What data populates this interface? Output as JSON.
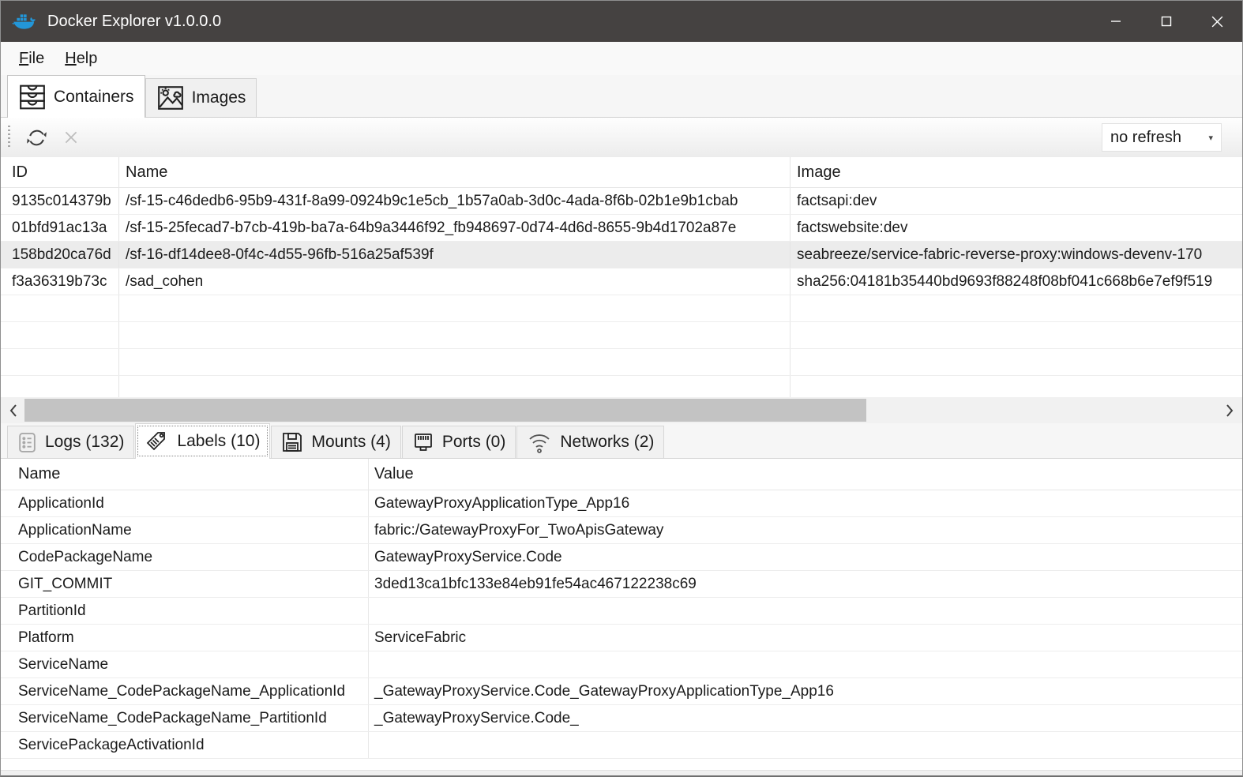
{
  "titlebar": {
    "title": "Docker Explorer v1.0.0.0"
  },
  "menubar": {
    "items": [
      {
        "label": "File"
      },
      {
        "label": "Help"
      }
    ]
  },
  "main_tabs": [
    {
      "label": "Containers",
      "active": true
    },
    {
      "label": "Images",
      "active": false
    }
  ],
  "toolbar": {
    "refresh_mode": "no refresh"
  },
  "containers_table": {
    "columns": [
      "ID",
      "Name",
      "Image"
    ],
    "selected_row_index": 2,
    "rows": [
      {
        "id": "9135c014379b",
        "name": "/sf-15-c46dedb6-95b9-431f-8a99-0924b9c1e5cb_1b57a0ab-3d0c-4ada-8f6b-02b1e9b1cbab",
        "image": "factsapi:dev"
      },
      {
        "id": "01bfd91ac13a",
        "name": "/sf-15-25fecad7-b7cb-419b-ba7a-64b9a3446f92_fb948697-0d74-4d6d-8655-9b4d1702a87e",
        "image": "factswebsite:dev"
      },
      {
        "id": "158bd20ca76d",
        "name": "/sf-16-df14dee8-0f4c-4d55-96fb-516a25af539f",
        "image": "seabreeze/service-fabric-reverse-proxy:windows-devenv-170"
      },
      {
        "id": "f3a36319b73c",
        "name": "/sad_cohen",
        "image": "sha256:04181b35440bd9693f88248f08bf041c668b6e7ef9f519"
      }
    ]
  },
  "detail_tabs": [
    {
      "label": "Logs (132)",
      "active": false
    },
    {
      "label": "Labels (10)",
      "active": true
    },
    {
      "label": "Mounts (4)",
      "active": false
    },
    {
      "label": "Ports (0)",
      "active": false
    },
    {
      "label": "Networks (2)",
      "active": false
    }
  ],
  "labels_table": {
    "columns": [
      "Name",
      "Value"
    ],
    "rows": [
      {
        "name": "ApplicationId",
        "value": "GatewayProxyApplicationType_App16"
      },
      {
        "name": "ApplicationName",
        "value": "fabric:/GatewayProxyFor_TwoApisGateway"
      },
      {
        "name": "CodePackageName",
        "value": "GatewayProxyService.Code"
      },
      {
        "name": "GIT_COMMIT",
        "value": "3ded13ca1bfc133e84eb91fe54ac467122238c69"
      },
      {
        "name": "PartitionId",
        "value": ""
      },
      {
        "name": "Platform",
        "value": "ServiceFabric"
      },
      {
        "name": "ServiceName",
        "value": ""
      },
      {
        "name": "ServiceName_CodePackageName_ApplicationId",
        "value": "_GatewayProxyService.Code_GatewayProxyApplicationType_App16"
      },
      {
        "name": "ServiceName_CodePackageName_PartitionId",
        "value": "_GatewayProxyService.Code_"
      },
      {
        "name": "ServicePackageActivationId",
        "value": ""
      }
    ]
  },
  "icons": {
    "docker-whale": "blue whale with containers",
    "containers-tab": "stacked drawers",
    "images-tab": "picture with sun and mountains",
    "refresh": "circular arrows",
    "clear": "x cross (disabled)",
    "combo-arrow": "▾",
    "scroll-left": "‹",
    "scroll-right": "›",
    "logs-tab": "note list",
    "labels-tab": "tag",
    "mounts-tab": "floppy disk",
    "ports-tab": "connector plug",
    "networks-tab": "wifi",
    "minimize": "—",
    "maximize": "□",
    "close": "✕"
  },
  "colors": {
    "titlebar_bg": "#454241",
    "docker_blue": "#2396d8",
    "selected_row": "#ececec",
    "scroll_thumb": "#c3c3c3"
  }
}
